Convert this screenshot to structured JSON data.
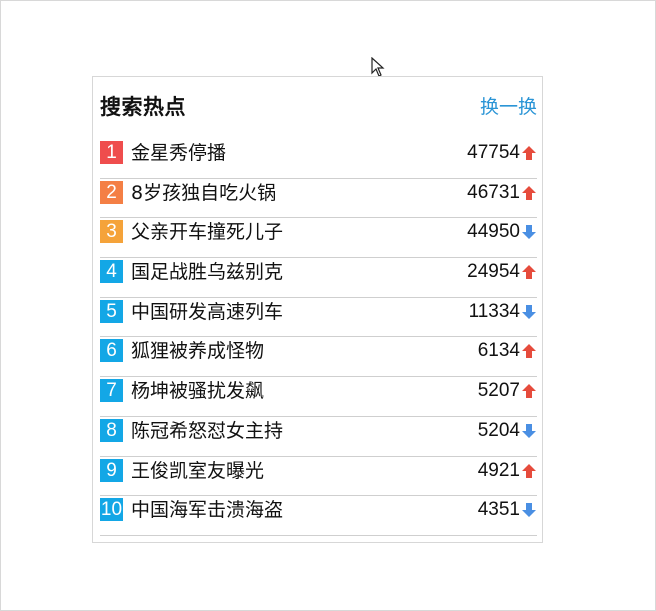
{
  "panel": {
    "title": "搜索热点",
    "refresh_label": "换一换"
  },
  "colors": {
    "rank_1": "#ef4d4d",
    "rank_2": "#f47f45",
    "rank_3": "#f5a33a",
    "rank_other": "#13a7e6",
    "trend_up": "#e64b3c",
    "trend_down": "#4a8fe3",
    "link": "#2b95d6"
  },
  "items": [
    {
      "rank": "1",
      "title": "金星秀停播",
      "count": "47754",
      "trend": "up"
    },
    {
      "rank": "2",
      "title": "8岁孩独自吃火锅",
      "count": "46731",
      "trend": "up"
    },
    {
      "rank": "3",
      "title": "父亲开车撞死儿子",
      "count": "44950",
      "trend": "down"
    },
    {
      "rank": "4",
      "title": "国足战胜乌兹别克",
      "count": "24954",
      "trend": "up"
    },
    {
      "rank": "5",
      "title": "中国研发高速列车",
      "count": "11334",
      "trend": "down"
    },
    {
      "rank": "6",
      "title": "狐狸被养成怪物",
      "count": "6134",
      "trend": "up"
    },
    {
      "rank": "7",
      "title": "杨坤被骚扰发飙",
      "count": "5207",
      "trend": "up"
    },
    {
      "rank": "8",
      "title": "陈冠希怒怼女主持",
      "count": "5204",
      "trend": "down"
    },
    {
      "rank": "9",
      "title": "王俊凯室友曝光",
      "count": "4921",
      "trend": "up"
    },
    {
      "rank": "10",
      "title": "中国海军击溃海盗",
      "count": "4351",
      "trend": "down"
    }
  ]
}
